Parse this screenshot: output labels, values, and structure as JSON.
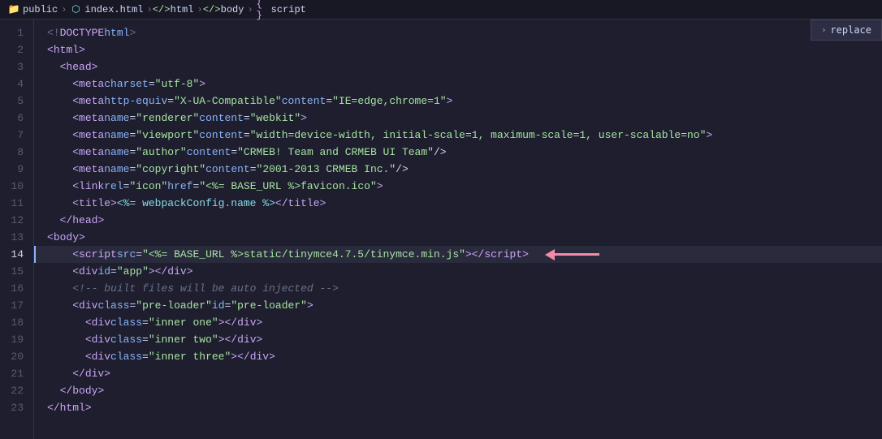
{
  "breadcrumb": {
    "items": [
      {
        "label": "public",
        "type": "folder"
      },
      {
        "label": ">",
        "type": "separator"
      },
      {
        "label": "index.html",
        "type": "html"
      },
      {
        "label": ">",
        "type": "separator"
      },
      {
        "label": "html",
        "type": "tag"
      },
      {
        "label": ">",
        "type": "separator"
      },
      {
        "label": "body",
        "type": "tag"
      },
      {
        "label": ">",
        "type": "separator"
      },
      {
        "label": "script",
        "type": "code"
      }
    ]
  },
  "replace_button": {
    "label": "replace"
  },
  "lines": [
    {
      "num": 1,
      "content": "<!DOCTYPE html>"
    },
    {
      "num": 2,
      "content": "<html>"
    },
    {
      "num": 3,
      "content": "  <head>"
    },
    {
      "num": 4,
      "content": "    <meta charset=\"utf-8\">"
    },
    {
      "num": 5,
      "content": "    <meta http-equiv=\"X-UA-Compatible\" content=\"IE=edge,chrome=1\">"
    },
    {
      "num": 6,
      "content": "    <meta name=\"renderer\" content=\"webkit\">"
    },
    {
      "num": 7,
      "content": "    <meta name=\"viewport\" content=\"width=device-width, initial-scale=1, maximum-scale=1, user-scalable=no\">"
    },
    {
      "num": 8,
      "content": "    <meta name=\"author\" content=\"CRMEB! Team and CRMEB UI Team\" />"
    },
    {
      "num": 9,
      "content": "    <meta name=\"copyright\" content=\"2001-2013 CRMEB Inc.\" />"
    },
    {
      "num": 10,
      "content": "    <link rel=\"icon\" href=\"<%= BASE_URL %>favicon.ico\">"
    },
    {
      "num": 11,
      "content": "    <title><%= webpackConfig.name %></title>"
    },
    {
      "num": 12,
      "content": "  </head>"
    },
    {
      "num": 13,
      "content": "<body>"
    },
    {
      "num": 14,
      "content": "    <script src=\"<%= BASE_URL %>static/tinymce4.7.5/tinymce.min.js\"><\\/script>",
      "highlighted": true
    },
    {
      "num": 15,
      "content": "    <div id=\"app\"></div>"
    },
    {
      "num": 16,
      "content": "    <!-- built files will be auto injected -->"
    },
    {
      "num": 17,
      "content": "    <div class=\"pre-loader\" id=\"pre-loader\">"
    },
    {
      "num": 18,
      "content": "      <div class=\"inner one\"></div>"
    },
    {
      "num": 19,
      "content": "      <div class=\"inner two\"></div>"
    },
    {
      "num": 20,
      "content": "      <div class=\"inner three\"></div>"
    },
    {
      "num": 21,
      "content": "    </div>"
    },
    {
      "num": 22,
      "content": "  </body>"
    },
    {
      "num": 23,
      "content": "</html>"
    }
  ]
}
